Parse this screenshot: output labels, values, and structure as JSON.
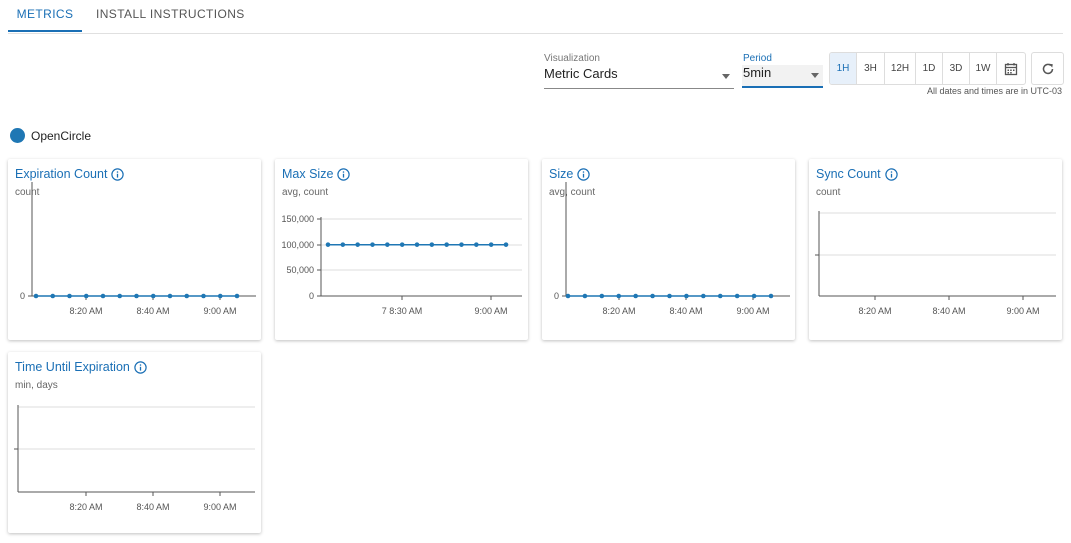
{
  "tabs": {
    "metrics": "METRICS",
    "install": "INSTALL INSTRUCTIONS"
  },
  "controls": {
    "visualization_label": "Visualization",
    "visualization_value": "Metric Cards",
    "period_label": "Period",
    "period_value": "5min",
    "time_ranges": [
      "1H",
      "3H",
      "12H",
      "1D",
      "3D",
      "1W"
    ],
    "selected_range": "1H",
    "timezone_note": "All dates and times are in UTC-03"
  },
  "legend": {
    "name": "OpenCircle",
    "color": "#1f77b4"
  },
  "cards": [
    {
      "title": "Expiration Count",
      "subtitle": "count"
    },
    {
      "title": "Max Size",
      "subtitle": "avg, count"
    },
    {
      "title": "Size",
      "subtitle": "avg, count"
    },
    {
      "title": "Sync Count",
      "subtitle": "count"
    },
    {
      "title": "Time Until Expiration",
      "subtitle": "min, days"
    }
  ],
  "chart_data": [
    {
      "type": "line",
      "title": "Expiration Count",
      "x_ticks": [
        "8:20 AM",
        "8:40 AM",
        "9:00 AM"
      ],
      "y_ticks": [
        "0"
      ],
      "series": [
        {
          "values": [
            0,
            0,
            0,
            0,
            0,
            0,
            0,
            0,
            0,
            0,
            0,
            0,
            0
          ]
        }
      ]
    },
    {
      "type": "line",
      "title": "Max Size",
      "x_ticks": [
        "7 8:30 AM",
        "9:00 AM"
      ],
      "y_ticks": [
        "150,000",
        "100,000",
        "50,000",
        "0"
      ],
      "ylim": [
        0,
        150000
      ],
      "grid": true,
      "series": [
        {
          "values": [
            100000,
            100000,
            100000,
            100000,
            100000,
            100000,
            100000,
            100000,
            100000,
            100000,
            100000,
            100000,
            100000
          ]
        }
      ]
    },
    {
      "type": "line",
      "title": "Size",
      "x_ticks": [
        "8:20 AM",
        "8:40 AM",
        "9:00 AM"
      ],
      "y_ticks": [
        "0"
      ],
      "series": [
        {
          "values": [
            0,
            0,
            0,
            0,
            0,
            0,
            0,
            0,
            0,
            0,
            0,
            0,
            0
          ]
        }
      ]
    },
    {
      "type": "line",
      "title": "Sync Count",
      "x_ticks": [
        "8:20 AM",
        "8:40 AM",
        "9:00 AM"
      ],
      "grid": true,
      "series": []
    },
    {
      "type": "line",
      "title": "Time Until Expiration",
      "x_ticks": [
        "8:20 AM",
        "8:40 AM",
        "9:00 AM"
      ],
      "grid": true,
      "series": []
    }
  ]
}
